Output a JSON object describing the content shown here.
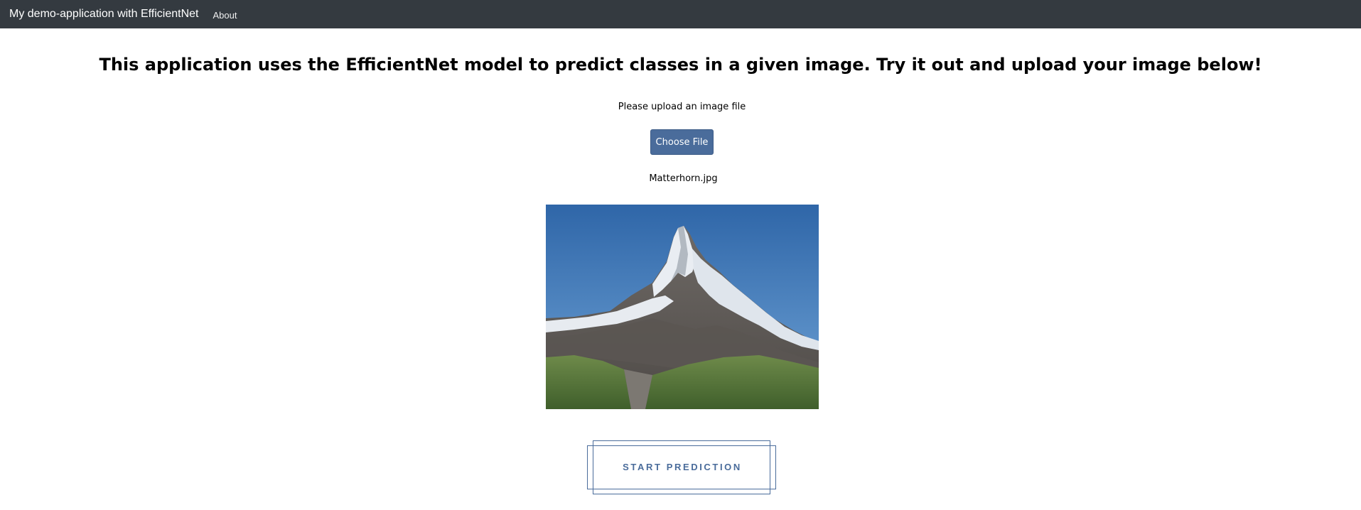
{
  "navbar": {
    "brand": "My demo-application with EfficientNet",
    "links": [
      {
        "label": "About"
      }
    ],
    "background": "#343a40"
  },
  "main": {
    "headline": "This application uses the EfficientNet model to predict classes in a given image. Try it out and upload your image below!",
    "upload_prompt": "Please upload an image file",
    "choose_file_label": "Choose File",
    "selected_file": "Matterhorn.jpg",
    "preview_alt": "Matterhorn.jpg",
    "predict_button_label": "START PREDICTION"
  },
  "colors": {
    "accent": "#4a6c9b",
    "navbar": "#343a40"
  }
}
